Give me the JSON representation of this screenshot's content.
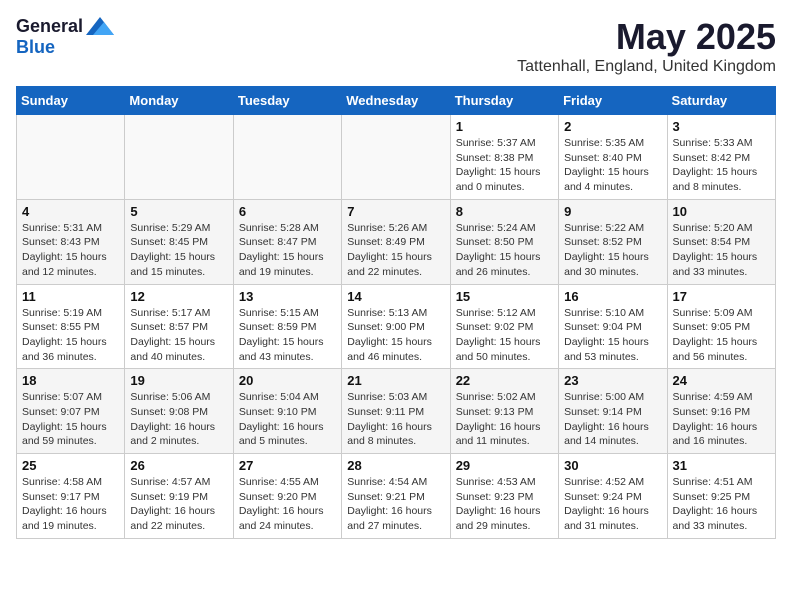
{
  "header": {
    "logo_general": "General",
    "logo_blue": "Blue",
    "month_title": "May 2025",
    "location": "Tattenhall, England, United Kingdom"
  },
  "weekdays": [
    "Sunday",
    "Monday",
    "Tuesday",
    "Wednesday",
    "Thursday",
    "Friday",
    "Saturday"
  ],
  "weeks": [
    [
      {
        "day": "",
        "info": ""
      },
      {
        "day": "",
        "info": ""
      },
      {
        "day": "",
        "info": ""
      },
      {
        "day": "",
        "info": ""
      },
      {
        "day": "1",
        "info": "Sunrise: 5:37 AM\nSunset: 8:38 PM\nDaylight: 15 hours\nand 0 minutes."
      },
      {
        "day": "2",
        "info": "Sunrise: 5:35 AM\nSunset: 8:40 PM\nDaylight: 15 hours\nand 4 minutes."
      },
      {
        "day": "3",
        "info": "Sunrise: 5:33 AM\nSunset: 8:42 PM\nDaylight: 15 hours\nand 8 minutes."
      }
    ],
    [
      {
        "day": "4",
        "info": "Sunrise: 5:31 AM\nSunset: 8:43 PM\nDaylight: 15 hours\nand 12 minutes."
      },
      {
        "day": "5",
        "info": "Sunrise: 5:29 AM\nSunset: 8:45 PM\nDaylight: 15 hours\nand 15 minutes."
      },
      {
        "day": "6",
        "info": "Sunrise: 5:28 AM\nSunset: 8:47 PM\nDaylight: 15 hours\nand 19 minutes."
      },
      {
        "day": "7",
        "info": "Sunrise: 5:26 AM\nSunset: 8:49 PM\nDaylight: 15 hours\nand 22 minutes."
      },
      {
        "day": "8",
        "info": "Sunrise: 5:24 AM\nSunset: 8:50 PM\nDaylight: 15 hours\nand 26 minutes."
      },
      {
        "day": "9",
        "info": "Sunrise: 5:22 AM\nSunset: 8:52 PM\nDaylight: 15 hours\nand 30 minutes."
      },
      {
        "day": "10",
        "info": "Sunrise: 5:20 AM\nSunset: 8:54 PM\nDaylight: 15 hours\nand 33 minutes."
      }
    ],
    [
      {
        "day": "11",
        "info": "Sunrise: 5:19 AM\nSunset: 8:55 PM\nDaylight: 15 hours\nand 36 minutes."
      },
      {
        "day": "12",
        "info": "Sunrise: 5:17 AM\nSunset: 8:57 PM\nDaylight: 15 hours\nand 40 minutes."
      },
      {
        "day": "13",
        "info": "Sunrise: 5:15 AM\nSunset: 8:59 PM\nDaylight: 15 hours\nand 43 minutes."
      },
      {
        "day": "14",
        "info": "Sunrise: 5:13 AM\nSunset: 9:00 PM\nDaylight: 15 hours\nand 46 minutes."
      },
      {
        "day": "15",
        "info": "Sunrise: 5:12 AM\nSunset: 9:02 PM\nDaylight: 15 hours\nand 50 minutes."
      },
      {
        "day": "16",
        "info": "Sunrise: 5:10 AM\nSunset: 9:04 PM\nDaylight: 15 hours\nand 53 minutes."
      },
      {
        "day": "17",
        "info": "Sunrise: 5:09 AM\nSunset: 9:05 PM\nDaylight: 15 hours\nand 56 minutes."
      }
    ],
    [
      {
        "day": "18",
        "info": "Sunrise: 5:07 AM\nSunset: 9:07 PM\nDaylight: 15 hours\nand 59 minutes."
      },
      {
        "day": "19",
        "info": "Sunrise: 5:06 AM\nSunset: 9:08 PM\nDaylight: 16 hours\nand 2 minutes."
      },
      {
        "day": "20",
        "info": "Sunrise: 5:04 AM\nSunset: 9:10 PM\nDaylight: 16 hours\nand 5 minutes."
      },
      {
        "day": "21",
        "info": "Sunrise: 5:03 AM\nSunset: 9:11 PM\nDaylight: 16 hours\nand 8 minutes."
      },
      {
        "day": "22",
        "info": "Sunrise: 5:02 AM\nSunset: 9:13 PM\nDaylight: 16 hours\nand 11 minutes."
      },
      {
        "day": "23",
        "info": "Sunrise: 5:00 AM\nSunset: 9:14 PM\nDaylight: 16 hours\nand 14 minutes."
      },
      {
        "day": "24",
        "info": "Sunrise: 4:59 AM\nSunset: 9:16 PM\nDaylight: 16 hours\nand 16 minutes."
      }
    ],
    [
      {
        "day": "25",
        "info": "Sunrise: 4:58 AM\nSunset: 9:17 PM\nDaylight: 16 hours\nand 19 minutes."
      },
      {
        "day": "26",
        "info": "Sunrise: 4:57 AM\nSunset: 9:19 PM\nDaylight: 16 hours\nand 22 minutes."
      },
      {
        "day": "27",
        "info": "Sunrise: 4:55 AM\nSunset: 9:20 PM\nDaylight: 16 hours\nand 24 minutes."
      },
      {
        "day": "28",
        "info": "Sunrise: 4:54 AM\nSunset: 9:21 PM\nDaylight: 16 hours\nand 27 minutes."
      },
      {
        "day": "29",
        "info": "Sunrise: 4:53 AM\nSunset: 9:23 PM\nDaylight: 16 hours\nand 29 minutes."
      },
      {
        "day": "30",
        "info": "Sunrise: 4:52 AM\nSunset: 9:24 PM\nDaylight: 16 hours\nand 31 minutes."
      },
      {
        "day": "31",
        "info": "Sunrise: 4:51 AM\nSunset: 9:25 PM\nDaylight: 16 hours\nand 33 minutes."
      }
    ]
  ]
}
